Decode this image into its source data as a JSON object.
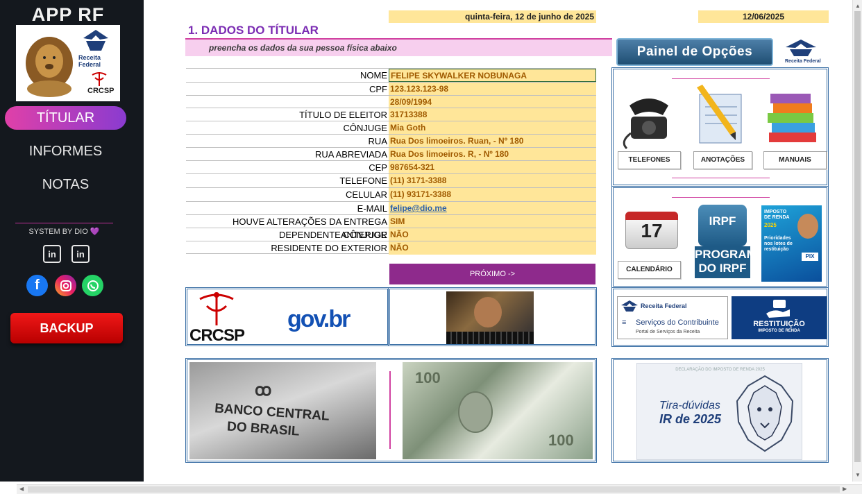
{
  "sidebar": {
    "app_title": "APP RF",
    "logo_text": {
      "receita": "Receita Federal",
      "crcsp": "CRCSP"
    },
    "nav": [
      {
        "label": "TÍTULAR",
        "active": true
      },
      {
        "label": "INFORMES",
        "active": false
      },
      {
        "label": "NOTAS",
        "active": false
      }
    ],
    "system_by": "SYSTEM BY DIO 💜",
    "backup_label": "BACKUP"
  },
  "header": {
    "date_long": "quinta-feira, 12 de junho de 2025",
    "date_short": "12/06/2025",
    "section_title": "1. DADOS DO TÍTULAR",
    "subtitle": "preencha os dados da sua pessoa física abaixo"
  },
  "form": {
    "rows": [
      {
        "label": "NOME",
        "value": "FELIPE SKYWALKER NOBUNAGA"
      },
      {
        "label": "CPF",
        "value": "123.123.123-98"
      },
      {
        "label": "",
        "value": "28/09/1994"
      },
      {
        "label": "TÍTULO DE ELEITOR",
        "value": "31713388"
      },
      {
        "label": "CÔNJUGE",
        "value": "Mia Goth"
      },
      {
        "label": "RUA",
        "value": "Rua Dos limoeiros. Ruan, - Nº 180"
      },
      {
        "label": "RUA ABREVIADA",
        "value": "Rua Dos limoeiros. R, - Nº 180"
      },
      {
        "label": "CEP",
        "value": "987654-321"
      },
      {
        "label": "TELEFONE",
        "value": "(11) 3171-3388"
      },
      {
        "label": "CELULAR",
        "value": "(11) 93171-3388"
      },
      {
        "label": "E-MAIL",
        "value": "felipe@dio.me"
      },
      {
        "label": "HOUVE ALTERAÇÕES DA ENTREGA ANTERIOR",
        "value": "SIM"
      },
      {
        "label": "DEPENDENTE CÔNJUGE",
        "value": "NÃO"
      },
      {
        "label": "RESIDENTE DO EXTERIOR",
        "value": "NÃO"
      }
    ],
    "next_label": "PRÓXIMO ->"
  },
  "panel": {
    "title": "Painel de Opções",
    "receita_label": "Receita Federal",
    "options": [
      "TELEFONES",
      "ANOTAÇÕES",
      "MANUAIS",
      "CALENDÁRIO"
    ],
    "calendar_day": "17",
    "irpf_text": {
      "top": "IRPF",
      "l1": "PROGRAMA",
      "l2": "DO IRPF"
    },
    "irpf_card": {
      "title": "IMPOSTO DE RENDA",
      "year": "2025",
      "body": "Prioridades nos lotes de restituição",
      "pix": "PIX"
    }
  },
  "links": {
    "crcsp": "CRCSP",
    "govbr": "gov.br",
    "servicos_title": "Serviços do Contribuinte",
    "servicos_sub": "Portal de Serviços da Receita",
    "servicos_brand": "Receita Federal",
    "restituicao_l1": "RESTITUIÇÃO",
    "restituicao_l2": "IMPOSTO DE RENDA",
    "banco_l1": "BANCO CENTRAL",
    "banco_l2": "DO BRASIL",
    "tira_l1": "Tira-dúvidas",
    "tira_l2": "IR de 2025",
    "tira_header": "DECLARAÇÃO DO IMPOSTO DE RENDA 2025"
  },
  "colors": {
    "accent": "#7b2cb3",
    "field_bg": "#ffe699",
    "field_text": "#a05a00",
    "sidebar_bg": "#14181e"
  }
}
